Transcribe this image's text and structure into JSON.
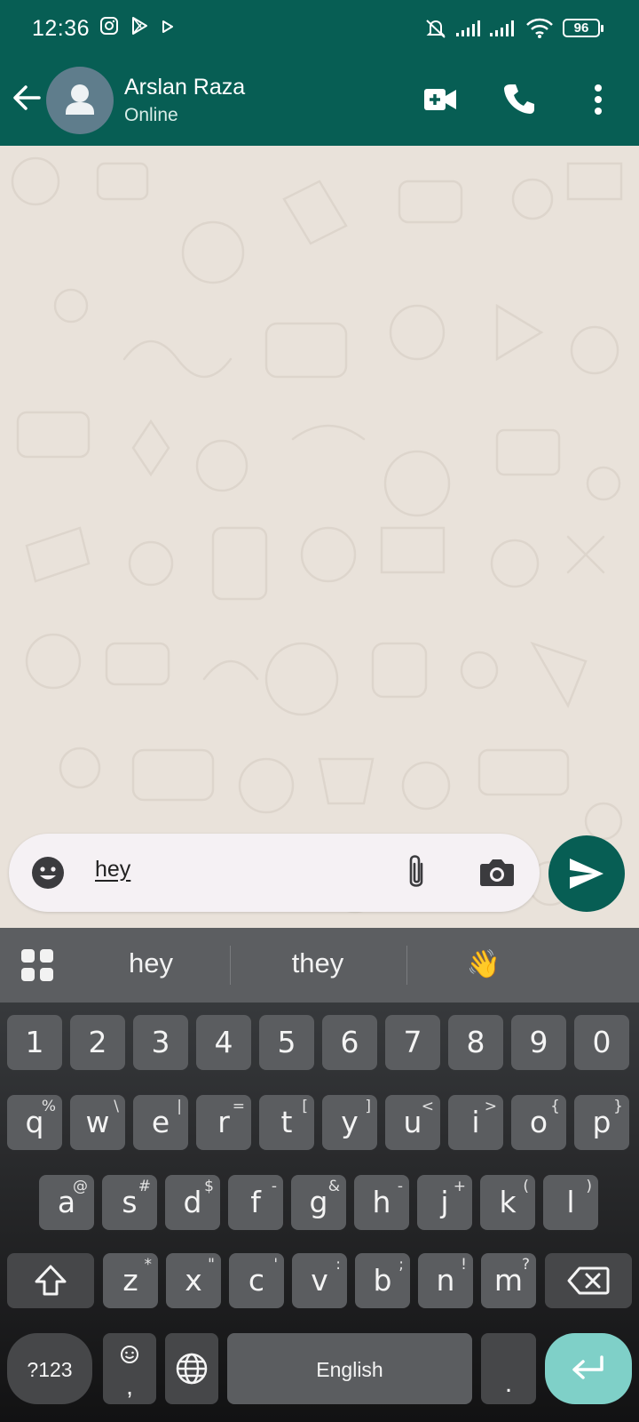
{
  "status_bar": {
    "time": "12:36",
    "battery": "96",
    "icons": [
      "instagram-icon",
      "play-store-icon",
      "play-icon",
      "mute-icon",
      "signal-icon",
      "signal-icon",
      "wifi-icon",
      "battery-icon"
    ]
  },
  "header": {
    "contact_name": "Arslan Raza",
    "contact_status": "Online",
    "icons": [
      "back-arrow-icon",
      "avatar-icon",
      "video-call-icon",
      "voice-call-icon",
      "more-options-icon"
    ],
    "color": "#075e54"
  },
  "composer": {
    "message": "hey",
    "icons": [
      "emoji-icon",
      "attach-icon",
      "camera-icon",
      "send-icon"
    ]
  },
  "keyboard": {
    "suggestions": [
      "hey",
      "they",
      "👋"
    ],
    "number_row": [
      "1",
      "2",
      "3",
      "4",
      "5",
      "6",
      "7",
      "8",
      "9",
      "0"
    ],
    "row1": [
      {
        "k": "q",
        "h": "%"
      },
      {
        "k": "w",
        "h": "\\"
      },
      {
        "k": "e",
        "h": "|"
      },
      {
        "k": "r",
        "h": "="
      },
      {
        "k": "t",
        "h": "["
      },
      {
        "k": "y",
        "h": "]"
      },
      {
        "k": "u",
        "h": "<"
      },
      {
        "k": "i",
        "h": ">"
      },
      {
        "k": "o",
        "h": "{"
      },
      {
        "k": "p",
        "h": "}"
      }
    ],
    "row2": [
      {
        "k": "a",
        "h": "@"
      },
      {
        "k": "s",
        "h": "#"
      },
      {
        "k": "d",
        "h": "$"
      },
      {
        "k": "f",
        "h": "-"
      },
      {
        "k": "g",
        "h": "&"
      },
      {
        "k": "h",
        "h": "-"
      },
      {
        "k": "j",
        "h": "+"
      },
      {
        "k": "k",
        "h": "("
      },
      {
        "k": "l",
        "h": ")"
      }
    ],
    "row3": [
      {
        "k": "z",
        "h": "*"
      },
      {
        "k": "x",
        "h": "\""
      },
      {
        "k": "c",
        "h": "'"
      },
      {
        "k": "v",
        "h": ":"
      },
      {
        "k": "b",
        "h": ";"
      },
      {
        "k": "n",
        "h": "!"
      },
      {
        "k": "m",
        "h": "?"
      }
    ],
    "symbols_label": "?123",
    "comma_label": ",",
    "space_label": "English",
    "period_label": ".",
    "enter_color": "#7fd0c8"
  }
}
